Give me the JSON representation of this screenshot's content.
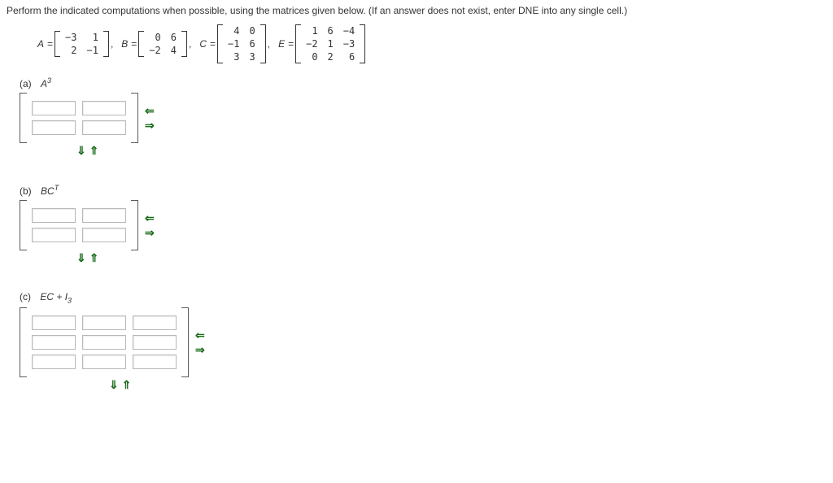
{
  "instructions": "Perform the indicated computations when possible, using the matrices given below. (If an answer does not exist, enter DNE into any single cell.)",
  "labels": {
    "A": "A",
    "B": "B",
    "C": "C",
    "E": "E",
    "eq": "="
  },
  "matrices": {
    "A": [
      [
        "−3",
        "1"
      ],
      [
        "2",
        "−1"
      ]
    ],
    "B": [
      [
        "0",
        "6"
      ],
      [
        "−2",
        "4"
      ]
    ],
    "C": [
      [
        "4",
        "0"
      ],
      [
        "−1",
        "6"
      ],
      [
        "3",
        "3"
      ]
    ],
    "E": [
      [
        "1",
        "6",
        "−4"
      ],
      [
        "−2",
        "1",
        "−3"
      ],
      [
        "0",
        "2",
        "6"
      ]
    ]
  },
  "arrows": {
    "left": "⇐",
    "right": "⇒",
    "down": "⇓",
    "up": "⇑"
  },
  "parts": {
    "a": {
      "tag": "(a)",
      "exprBase": "A",
      "exprSup": "3",
      "rows": 2,
      "cols": 2
    },
    "b": {
      "tag": "(b)",
      "exprBase": "BC",
      "exprSup": "T",
      "rows": 2,
      "cols": 2
    },
    "c": {
      "tag": "(c)",
      "exprBase": "EC + I",
      "exprSub": "3",
      "rows": 3,
      "cols": 3
    }
  }
}
